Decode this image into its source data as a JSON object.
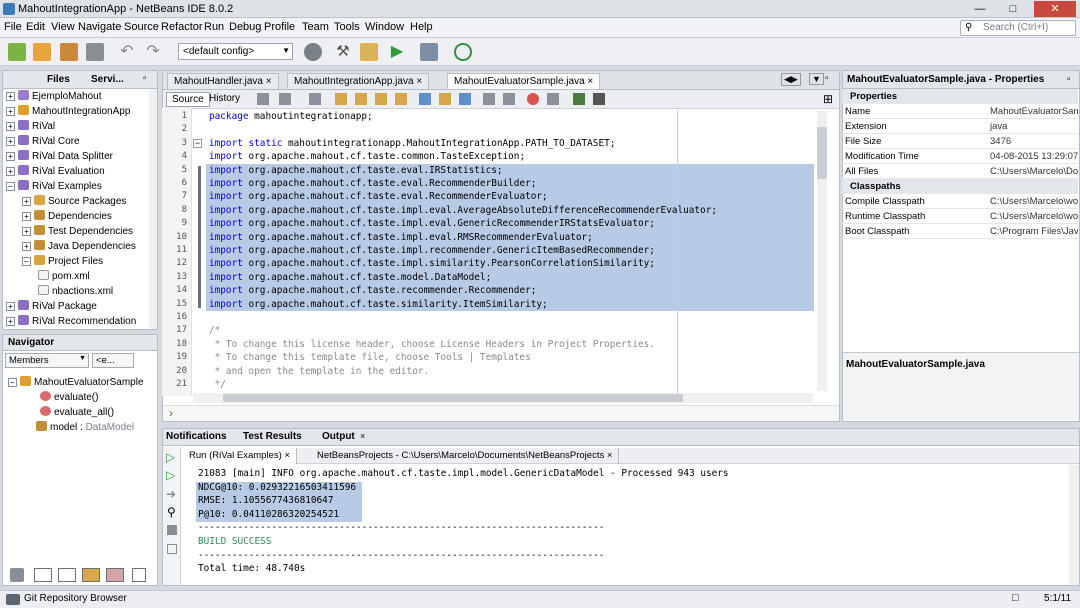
{
  "window": {
    "title": "MahoutIntegrationApp - NetBeans IDE 8.0.2"
  },
  "menu": [
    "File",
    "Edit",
    "View",
    "Navigate",
    "Source",
    "Refactor",
    "Run",
    "Debug",
    "Profile",
    "Team",
    "Tools",
    "Window",
    "Help"
  ],
  "search": {
    "placeholder": "Search (Ctrl+I)"
  },
  "toolbar": {
    "config": "<default config>"
  },
  "left_tabs": {
    "files": "Files",
    "services": "Servi..."
  },
  "tree": [
    {
      "label": "EjemploMahout"
    },
    {
      "label": "MahoutIntegrationApp"
    },
    {
      "label": "RiVal"
    },
    {
      "label": "RiVal Core"
    },
    {
      "label": "RiVal Data Splitter"
    },
    {
      "label": "RiVal Evaluation"
    },
    {
      "label": "RiVal Examples"
    },
    {
      "label": "Source Packages"
    },
    {
      "label": "Dependencies"
    },
    {
      "label": "Test Dependencies"
    },
    {
      "label": "Java Dependencies"
    },
    {
      "label": "Project Files"
    },
    {
      "label": "pom.xml"
    },
    {
      "label": "nbactions.xml"
    },
    {
      "label": "RiVal Package"
    },
    {
      "label": "RiVal Recommendation"
    }
  ],
  "navigator": {
    "title": "Navigator",
    "filter": "Members",
    "filter2": "<e...",
    "items": [
      {
        "label": "MahoutEvaluatorSample"
      },
      {
        "label": "evaluate()"
      },
      {
        "label": "evaluate_all()"
      },
      {
        "label": "model : ",
        "type": "DataModel"
      }
    ]
  },
  "editor": {
    "tabs": [
      "MahoutHandler.java",
      "MahoutIntegrationApp.java",
      "MahoutEvaluatorSample.java"
    ],
    "source_btn": "Source",
    "history_btn": "History",
    "selection_lines": [
      5,
      15
    ],
    "lines": [
      {
        "n": "1",
        "kw": "package",
        "rest": " mahoutintegrationapp;"
      },
      {
        "n": "2",
        "kw": "",
        "rest": ""
      },
      {
        "n": "3",
        "kw": "import static",
        "rest": " mahoutintegrationapp.MahoutIntegrationApp.PATH_TO_DATASET;"
      },
      {
        "n": "4",
        "kw": "import",
        "rest": " org.apache.mahout.cf.taste.common.TasteException;"
      },
      {
        "n": "5",
        "kw": "import",
        "rest": " org.apache.mahout.cf.taste.eval.IRStatistics;"
      },
      {
        "n": "6",
        "kw": "import",
        "rest": " org.apache.mahout.cf.taste.eval.RecommenderBuilder;"
      },
      {
        "n": "7",
        "kw": "import",
        "rest": " org.apache.mahout.cf.taste.eval.RecommenderEvaluator;"
      },
      {
        "n": "8",
        "kw": "import",
        "rest": " org.apache.mahout.cf.taste.impl.eval.AverageAbsoluteDifferenceRecommenderEvaluator;"
      },
      {
        "n": "9",
        "kw": "import",
        "rest": " org.apache.mahout.cf.taste.impl.eval.GenericRecommenderIRStatsEvaluator;"
      },
      {
        "n": "10",
        "kw": "import",
        "rest": " org.apache.mahout.cf.taste.impl.eval.RMSRecommenderEvaluator;"
      },
      {
        "n": "11",
        "kw": "import",
        "rest": " org.apache.mahout.cf.taste.impl.recommender.GenericItemBasedRecommender;"
      },
      {
        "n": "12",
        "kw": "import",
        "rest": " org.apache.mahout.cf.taste.impl.similarity.PearsonCorrelationSimilarity;"
      },
      {
        "n": "13",
        "kw": "import",
        "rest": " org.apache.mahout.cf.taste.model.DataModel;"
      },
      {
        "n": "14",
        "kw": "import",
        "rest": " org.apache.mahout.cf.taste.recommender.Recommender;"
      },
      {
        "n": "15",
        "kw": "import",
        "rest": " org.apache.mahout.cf.taste.similarity.ItemSimilarity;"
      },
      {
        "n": "16",
        "kw": "",
        "rest": ""
      },
      {
        "n": "17",
        "kw": "",
        "rest": "/*",
        "c": true
      },
      {
        "n": "18",
        "kw": "",
        "rest": " * To change this license header, choose License Headers in Project Properties.",
        "c": true
      },
      {
        "n": "19",
        "kw": "",
        "rest": " * To change this template file, choose Tools | Templates",
        "c": true
      },
      {
        "n": "20",
        "kw": "",
        "rest": " * and open the template in the editor.",
        "c": true
      },
      {
        "n": "21",
        "kw": "",
        "rest": " */",
        "c": true
      }
    ]
  },
  "properties": {
    "title": "MahoutEvaluatorSample.java - Properties",
    "section1": "Properties",
    "rows1": [
      {
        "k": "Name",
        "v": "MahoutEvaluatorSam"
      },
      {
        "k": "Extension",
        "v": "java"
      },
      {
        "k": "File Size",
        "v": "3476"
      },
      {
        "k": "Modification Time",
        "v": "04-08-2015 13:29:07"
      },
      {
        "k": "All Files",
        "v": "C:\\Users\\Marcelo\\Do"
      }
    ],
    "section2": "Classpaths",
    "rows2": [
      {
        "k": "Compile Classpath",
        "v": "C:\\Users\\Marcelo\\wo"
      },
      {
        "k": "Runtime Classpath",
        "v": "C:\\Users\\Marcelo\\wo"
      },
      {
        "k": "Boot Classpath",
        "v": "C:\\Program Files\\Java"
      }
    ],
    "footer": "MahoutEvaluatorSample.java"
  },
  "output": {
    "tabs": [
      "Notifications",
      "Test Results",
      "Output"
    ],
    "subtabs": [
      "Run (RiVal Examples)",
      "NetBeansProjects - C:\\Users\\Marcelo\\Documents\\NetBeansProjects"
    ],
    "selection_lines": [
      1,
      3
    ],
    "lines": [
      "21083 [main] INFO org.apache.mahout.cf.taste.impl.model.GenericDataModel - Processed 943 users",
      "NDCG@10: 0.02932216503411596",
      "RMSE: 1.1055677436810647",
      "P@10: 0.04110286320254521",
      "------------------------------------------------------------------------",
      "BUILD SUCCESS",
      "------------------------------------------------------------------------",
      "Total time: 48.740s"
    ]
  },
  "status": {
    "git": "Git Repository Browser",
    "pos": "5:1/11"
  },
  "colors": {
    "keyword": "#0000e6",
    "comment": "#8a8a8a",
    "selection": "#b8cbe6",
    "success": "#2e8b57"
  }
}
